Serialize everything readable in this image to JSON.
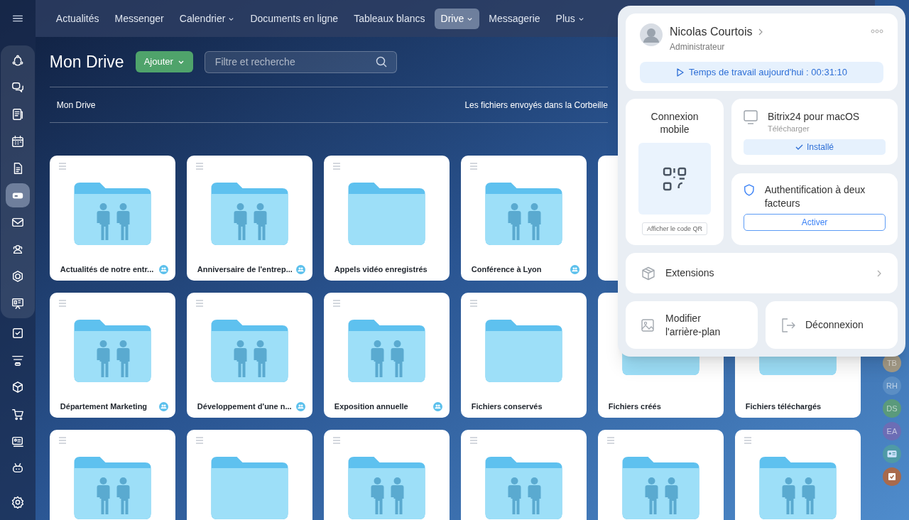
{
  "sidebar": {
    "items": [
      {
        "selected": false
      },
      {
        "selected": false
      },
      {
        "selected": false
      },
      {
        "selected": false
      },
      {
        "selected": false
      },
      {
        "selected": true
      },
      {
        "selected": false
      },
      {
        "selected": false
      },
      {
        "selected": false
      },
      {
        "selected": false
      },
      {
        "selected": false
      },
      {
        "selected": false
      },
      {
        "selected": false
      },
      {
        "selected": false
      },
      {
        "selected": false
      },
      {
        "selected": false
      },
      {
        "selected": false
      }
    ]
  },
  "nav": {
    "tabs": [
      {
        "label": "Actualités",
        "dropdown": false,
        "selected": false
      },
      {
        "label": "Messenger",
        "dropdown": false,
        "selected": false
      },
      {
        "label": "Calendrier",
        "dropdown": true,
        "selected": false
      },
      {
        "label": "Documents en ligne",
        "dropdown": false,
        "selected": false
      },
      {
        "label": "Tableaux blancs",
        "dropdown": false,
        "selected": false
      },
      {
        "label": "Drive",
        "dropdown": true,
        "selected": true
      },
      {
        "label": "Messagerie",
        "dropdown": false,
        "selected": false
      },
      {
        "label": "Plus",
        "dropdown": true,
        "selected": false
      }
    ]
  },
  "page": {
    "title": "Mon Drive",
    "add_button": "Ajouter",
    "search": {
      "placeholder": "Filtre et recherche"
    },
    "breadcrumb": "Mon Drive",
    "trash_note": "Les fichiers envoyés dans la Corbeille"
  },
  "folder_rows": [
    [
      {
        "name": "Actualités de notre entr...",
        "shared": true
      },
      {
        "name": "Anniversaire de l'entrep...",
        "shared": true
      },
      {
        "name": "Appels vidéo enregistrés",
        "shared": false
      },
      {
        "name": "Conférence à Lyon",
        "shared": true
      }
    ],
    [
      {
        "name": "Département Marketing",
        "shared": true
      },
      {
        "name": "Développement d'une n...",
        "shared": true
      },
      {
        "name": "Exposition annuelle",
        "shared": true
      },
      {
        "name": "Fichiers conservés",
        "shared": false
      },
      {
        "name": "Fichiers créés",
        "shared": false
      },
      {
        "name": "Fichiers téléchargés",
        "shared": false
      }
    ],
    [
      {
        "shared": true
      },
      {
        "shared": false
      },
      {
        "shared": true
      },
      {
        "shared": true
      },
      {
        "shared": true
      },
      {
        "shared": true
      }
    ]
  ],
  "right_rail": [
    {
      "kind": "initials",
      "initials": "TB",
      "color": "#a39a86"
    },
    {
      "kind": "initials",
      "initials": "RH",
      "color": "#5b8ec4"
    },
    {
      "kind": "initials",
      "initials": "DS",
      "color": "#5a9a7c"
    },
    {
      "kind": "initials",
      "initials": "EA",
      "color": "#6c6db5"
    },
    {
      "kind": "contacts",
      "color": "#4f9aa6"
    },
    {
      "kind": "tasks",
      "color": "#a86a4c"
    }
  ],
  "profile_menu": {
    "user": {
      "name": "Nicolas Courtois",
      "role": "Administrateur"
    },
    "work_time": "Temps de travail aujourd'hui : 00:31:10",
    "mobile": {
      "title": "Connexion mobile",
      "qr_button": "Afficher le code QR"
    },
    "desktop_app": {
      "title": "Bitrix24 pour macOS",
      "subtitle": "Télécharger",
      "status": "Installé",
      "installed": true
    },
    "two_factor": {
      "title": "Authentification à deux facteurs",
      "button": "Activer"
    },
    "extensions": "Extensions",
    "background": "Modifier l'arrière-plan",
    "logout": "Déconnexion"
  }
}
